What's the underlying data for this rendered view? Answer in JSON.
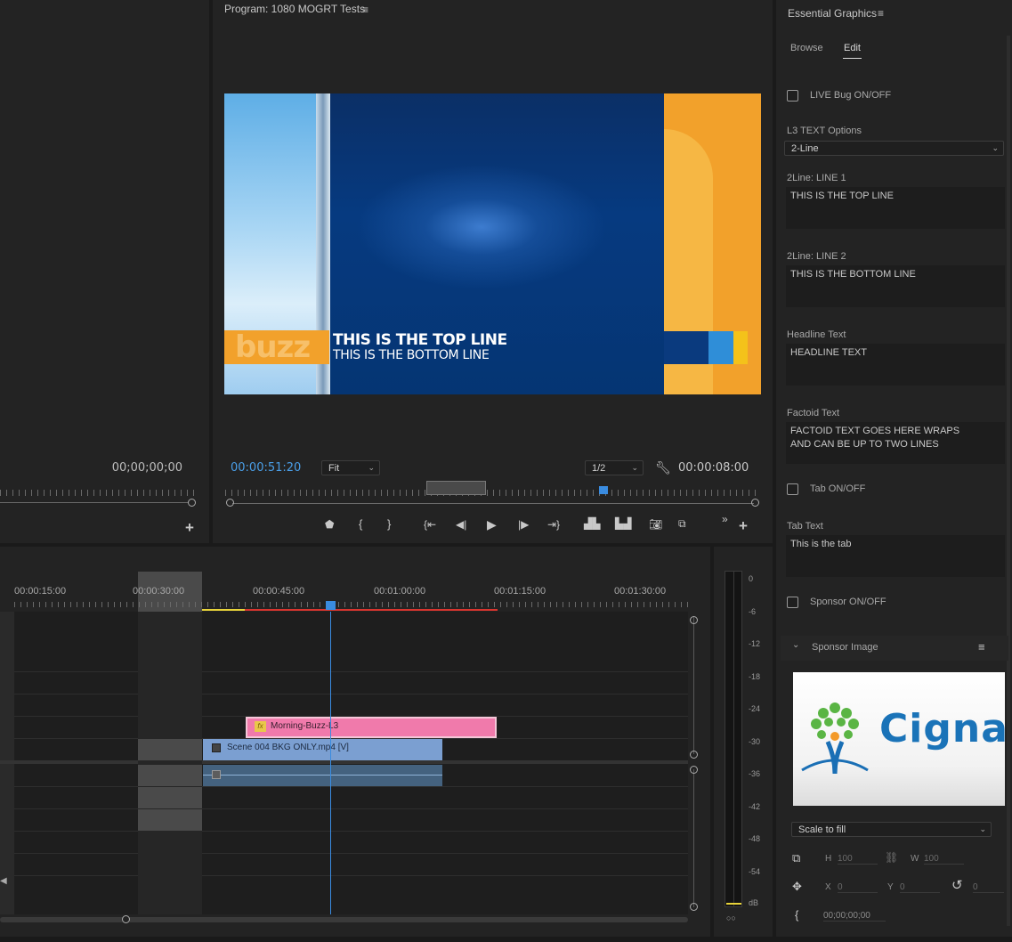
{
  "source_monitor": {
    "timecode": "00;00;00;00"
  },
  "program_monitor": {
    "title": "Program: 1080 MOGRT Tests",
    "timecode_current": "00:00:51:20",
    "zoom": "Fit",
    "resolution": "1/2",
    "timecode_duration": "00:00:08:00",
    "video": {
      "logo_text": "buzz",
      "top_line": "THIS IS THE TOP LINE",
      "bottom_line": "THIS IS THE BOTTOM LINE"
    }
  },
  "timeline": {
    "ruler_labels": [
      "00:00:15:00",
      "00:00:30:00",
      "00:00:45:00",
      "00:01:00:00",
      "00:01:15:00",
      "00:01:30:00"
    ],
    "clips": {
      "graphic": "Morning-Buzz-L3",
      "video": "Scene 004 BKG ONLY.mp4 [V]"
    }
  },
  "audio_meter": {
    "scale": [
      "0",
      "-6",
      "-12",
      "-18",
      "-24",
      "-30",
      "-36",
      "-42",
      "-48",
      "-54",
      "dB"
    ]
  },
  "essential_graphics": {
    "title": "Essential Graphics",
    "tabs": [
      "Browse",
      "Edit"
    ],
    "active_tab": "Edit",
    "live_bug_label": "LIVE Bug ON/OFF",
    "l3_options_label": "L3 TEXT Options",
    "l3_options_value": "2-Line",
    "line1_label": "2Line: LINE 1",
    "line1_value": "THIS IS THE TOP LINE",
    "line2_label": "2Line: LINE 2",
    "line2_value": "THIS IS THE BOTTOM LINE",
    "headline_label": "Headline Text",
    "headline_value": "HEADLINE TEXT",
    "factoid_label": "Factoid Text",
    "factoid_value": "FACTOID TEXT GOES HERE WRAPS AND CAN BE UP TO TWO LINES",
    "tab_toggle_label": "Tab ON/OFF",
    "tab_text_label": "Tab Text",
    "tab_text_value": "This is the tab",
    "sponsor_toggle_label": "Sponsor ON/OFF",
    "sponsor_image_label": "Sponsor Image",
    "sponsor_logo_text": "Cigna",
    "scale_mode": "Scale to fill",
    "h_label": "H",
    "h_value": "100",
    "w_label": "W",
    "w_value": "100",
    "x_label": "X",
    "x_value": "0",
    "y_label": "Y",
    "y_value": "0",
    "rotation_value": "0",
    "time_value": "00;00;00;00"
  },
  "colors": {
    "accent_blue": "#4a9fe8",
    "graphic_clip": "#f07aab",
    "video_clip": "#7b9fd1",
    "playhead": "#3a8ce0",
    "orange": "#f2a12b"
  }
}
